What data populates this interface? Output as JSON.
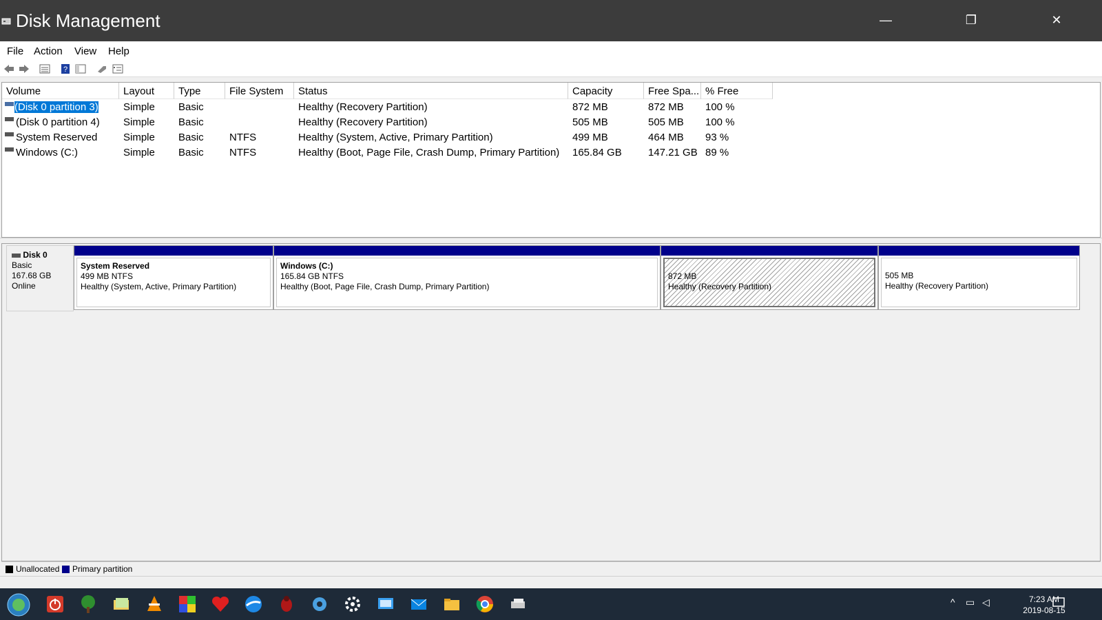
{
  "window": {
    "title": "Disk Management",
    "min": "—",
    "max": "❐",
    "close": "✕"
  },
  "menu": [
    "File",
    "Action",
    "View",
    "Help"
  ],
  "columns": [
    "Volume",
    "Layout",
    "Type",
    "File System",
    "Status",
    "Capacity",
    "Free Spa...",
    "% Free"
  ],
  "volumes": [
    {
      "volume": "(Disk 0 partition 3)",
      "layout": "Simple",
      "type": "Basic",
      "fs": "",
      "status": "Healthy (Recovery Partition)",
      "capacity": "872 MB",
      "free": "872 MB",
      "pct": "100 %"
    },
    {
      "volume": "(Disk 0 partition 4)",
      "layout": "Simple",
      "type": "Basic",
      "fs": "",
      "status": "Healthy (Recovery Partition)",
      "capacity": "505 MB",
      "free": "505 MB",
      "pct": "100 %"
    },
    {
      "volume": "System Reserved",
      "layout": "Simple",
      "type": "Basic",
      "fs": "NTFS",
      "status": "Healthy (System, Active, Primary Partition)",
      "capacity": "499 MB",
      "free": "464 MB",
      "pct": "93 %"
    },
    {
      "volume": "Windows (C:)",
      "layout": "Simple",
      "type": "Basic",
      "fs": "NTFS",
      "status": "Healthy (Boot, Page File, Crash Dump, Primary Partition)",
      "capacity": "165.84 GB",
      "free": "147.21 GB",
      "pct": "89 %"
    }
  ],
  "disk": {
    "name": "Disk 0",
    "type": "Basic",
    "size": "167.68 GB",
    "state": "Online"
  },
  "partitions": [
    {
      "name": "System Reserved",
      "size": "499 MB NTFS",
      "status": "Healthy (System, Active, Primary Partition)"
    },
    {
      "name": "Windows  (C:)",
      "size": "165.84 GB NTFS",
      "status": "Healthy (Boot, Page File, Crash Dump, Primary Partition)"
    },
    {
      "name": "",
      "size": "872 MB",
      "status": "Healthy (Recovery Partition)"
    },
    {
      "name": "",
      "size": "505 MB",
      "status": "Healthy (Recovery Partition)"
    }
  ],
  "legend": {
    "unallocated": "Unallocated",
    "primary": "Primary partition"
  },
  "colors": {
    "primary": "#00008b",
    "unallocated": "#000000",
    "selection": "#0078d7"
  },
  "taskbar_icons": [
    "start-orb-icon",
    "power-icon",
    "tree-icon",
    "folders-icon",
    "vlc-icon",
    "color-picker-icon",
    "heart-icon",
    "browser-icon",
    "bug-icon",
    "settings-gear-icon",
    "settings-icon",
    "monitor-icon",
    "mail-icon",
    "file-explorer-icon",
    "chrome-icon",
    "disk-management-icon"
  ],
  "tray": {
    "time": "7:23 AM",
    "date": "2019-08-15"
  }
}
